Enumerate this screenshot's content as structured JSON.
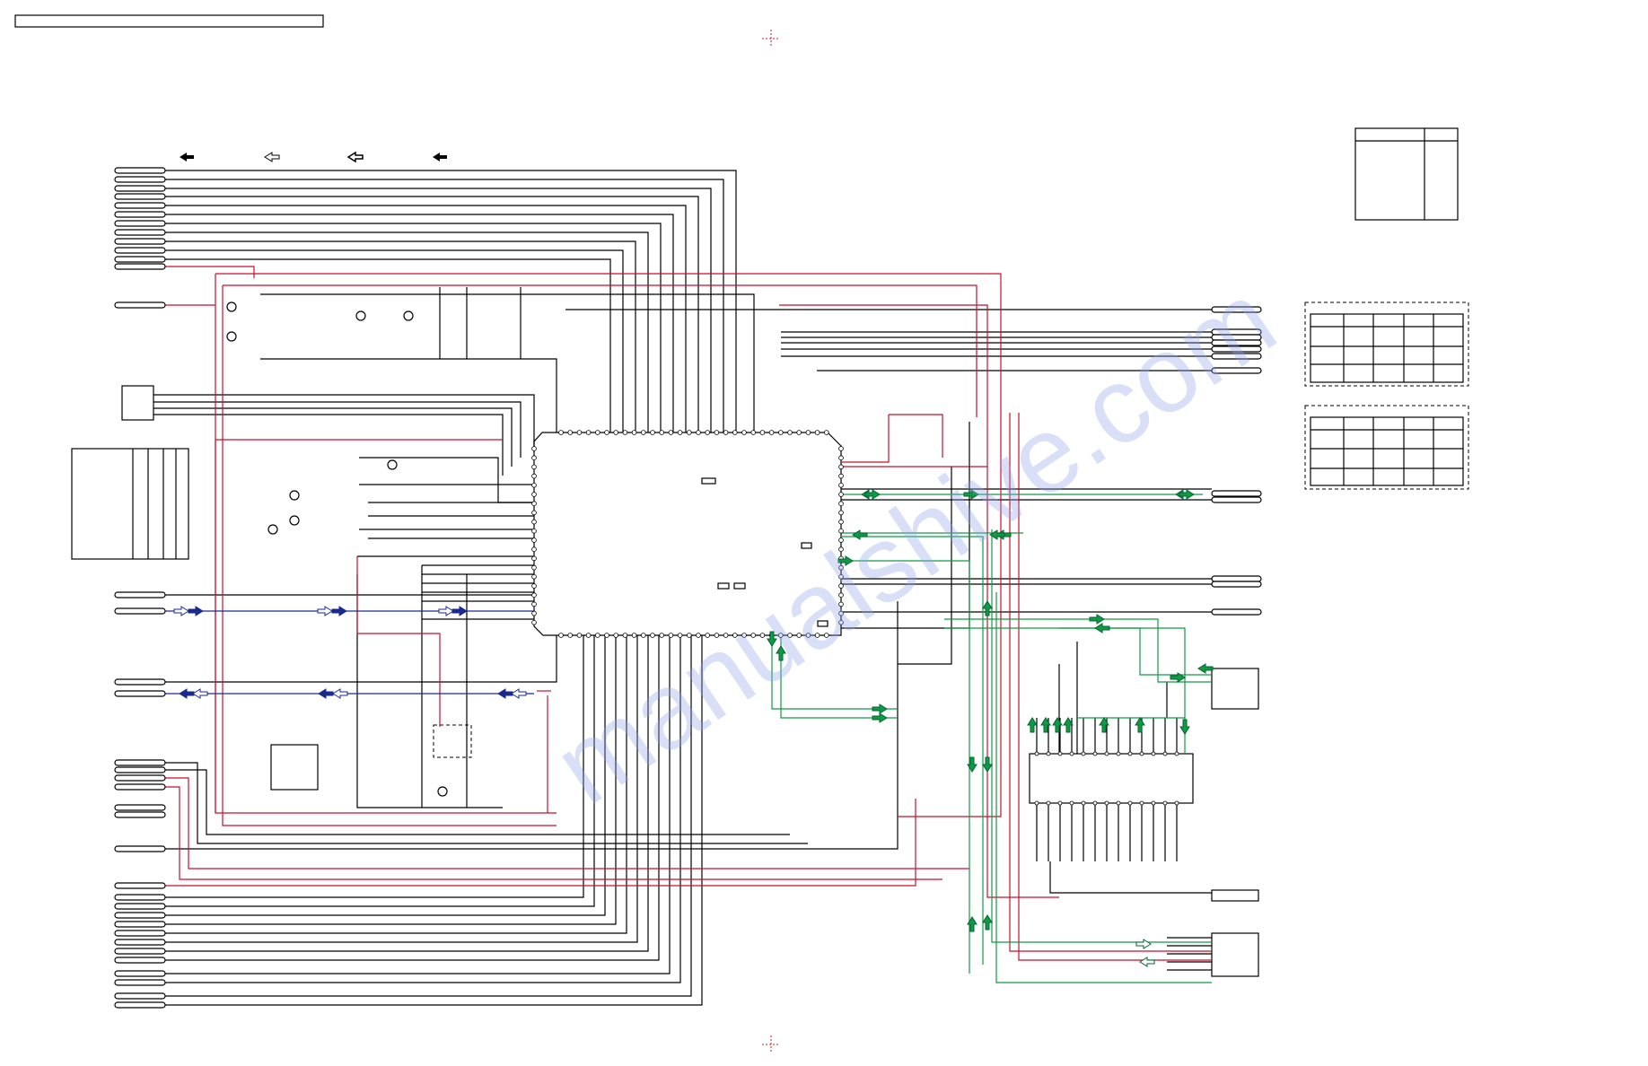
{
  "page": {
    "title_bar_text": ""
  },
  "colors": {
    "signal_black": "#000000",
    "power_red": "#c8102e",
    "signal_green": "#119944",
    "signal_blue": "#1a2a8c",
    "registration_mark": "#d81b1b",
    "watermark": "#8fa3e8"
  },
  "watermark": {
    "text": "manualshive.com"
  },
  "icons": {
    "registration_mark": "crosshair-icon",
    "signal_arrow": "arrow-icon"
  }
}
